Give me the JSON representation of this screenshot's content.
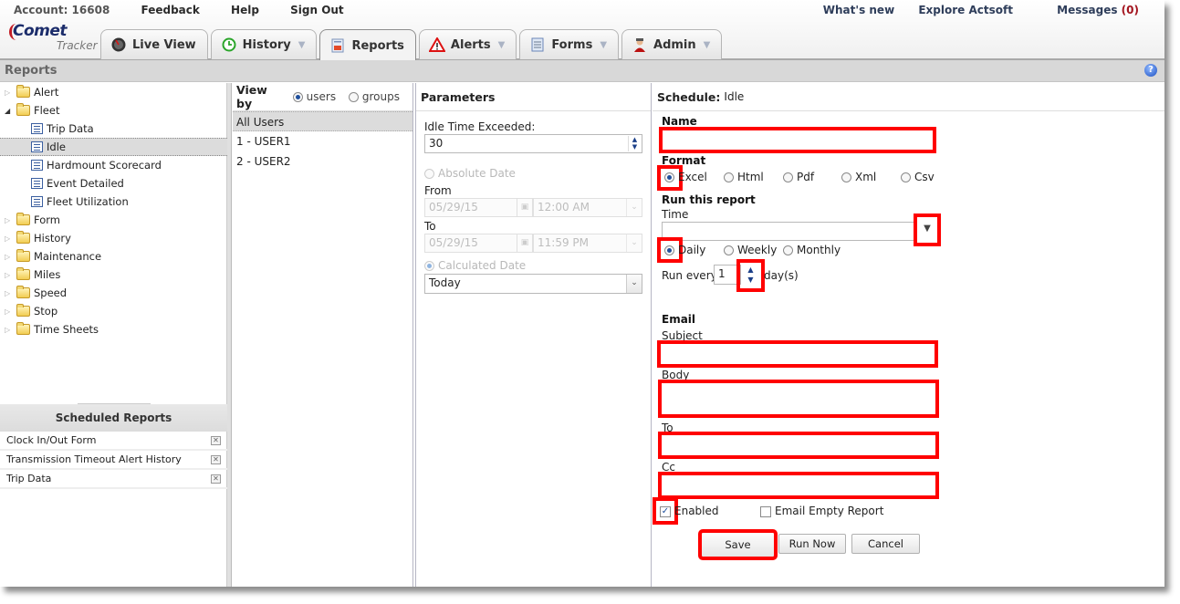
{
  "header": {
    "account": "Account: 16608",
    "links": [
      "Feedback",
      "Help",
      "Sign Out"
    ],
    "right_links": {
      "whats_new": "What's new",
      "explore": "Explore Actsoft",
      "messages": "Messages",
      "message_count": "(0)"
    },
    "logo": {
      "line1": "Comet",
      "line2": "Tracker"
    },
    "tabs": [
      {
        "label": "Live View",
        "icon": "speedometer-icon",
        "dropdown": false
      },
      {
        "label": "History",
        "icon": "clock-icon",
        "dropdown": true
      },
      {
        "label": "Reports",
        "icon": "reports-icon",
        "dropdown": false,
        "active": true
      },
      {
        "label": "Alerts",
        "icon": "warning-icon",
        "dropdown": true
      },
      {
        "label": "Forms",
        "icon": "document-icon",
        "dropdown": true
      },
      {
        "label": "Admin",
        "icon": "user-icon",
        "dropdown": true
      }
    ]
  },
  "reports_bar": {
    "title": "Reports",
    "help_icon": "?"
  },
  "tree": {
    "folders": [
      {
        "label": "Alert",
        "open": false
      },
      {
        "label": "Fleet",
        "open": true,
        "children": [
          "Trip Data",
          "Idle",
          "Hardmount Scorecard",
          "Event Detailed",
          "Fleet Utilization"
        ],
        "selected": "Idle"
      },
      {
        "label": "Form",
        "open": false
      },
      {
        "label": "History",
        "open": false
      },
      {
        "label": "Maintenance",
        "open": false
      },
      {
        "label": "Miles",
        "open": false
      },
      {
        "label": "Speed",
        "open": false
      },
      {
        "label": "Stop",
        "open": false
      },
      {
        "label": "Time Sheets",
        "open": false
      }
    ]
  },
  "scheduled_reports": {
    "title": "Scheduled Reports",
    "items": [
      "Clock In/Out Form",
      "Transmission Timeout Alert History",
      "Trip Data"
    ]
  },
  "view_by": {
    "label": "View by",
    "options": [
      "users",
      "groups"
    ],
    "selected": "users",
    "users": [
      "All Users",
      "1 - USER1",
      "2 - USER2"
    ],
    "selected_user": "All Users"
  },
  "parameters": {
    "title": "Parameters",
    "idle_label": "Idle Time Exceeded:",
    "idle_value": "30",
    "absolute_date_label": "Absolute Date",
    "from_label": "From",
    "from_date": "05/29/15",
    "from_time": "12:00 AM",
    "to_label": "To",
    "to_date": "05/29/15",
    "to_time": "11:59 PM",
    "calculated_date_label": "Calculated Date",
    "calculated_value": "Today"
  },
  "schedule": {
    "title_label": "Schedule:",
    "title_value": "Idle",
    "name_label": "Name",
    "name_value": "",
    "format_label": "Format",
    "formats": [
      "Excel",
      "Html",
      "Pdf",
      "Xml",
      "Csv"
    ],
    "selected_format": "Excel",
    "run_label": "Run this report",
    "time_label": "Time",
    "time_value": "",
    "frequencies": [
      "Daily",
      "Weekly",
      "Monthly"
    ],
    "selected_frequency": "Daily",
    "run_every_label": "Run every",
    "run_every_value": "1",
    "run_every_unit": "day(s)",
    "email_label": "Email",
    "subject_label": "Subject",
    "body_label": "Body",
    "to_label": "To",
    "cc_label": "Cc",
    "enabled_label": "Enabled",
    "enabled": true,
    "email_empty_label": "Email Empty Report",
    "email_empty": false,
    "buttons": {
      "save": "Save",
      "run_now": "Run Now",
      "cancel": "Cancel"
    },
    "highlight_color": "#ff0000"
  }
}
